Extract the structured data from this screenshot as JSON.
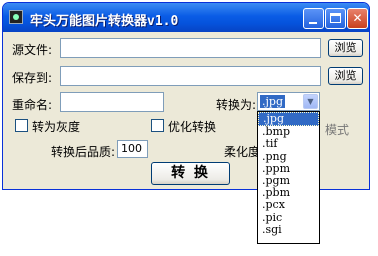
{
  "window": {
    "title": "牢头万能图片转换器v1.0",
    "minimize": "",
    "maximize": "",
    "close": "✕"
  },
  "form": {
    "source_label": "源文件:",
    "source_value": "",
    "browse1": "浏览",
    "save_label": "保存到:",
    "save_value": "",
    "browse2": "浏览",
    "rename_label": "重命名:",
    "rename_value": "",
    "convert_to_label": "转换为:",
    "format_selected": ".jpg",
    "gray_label": "转为灰度",
    "optimize_label": "优化转换",
    "mode_label": "模式",
    "quality_label": "转换后品质:",
    "quality_value": "100",
    "soften_label": "柔化度",
    "convert_button": "转 换"
  },
  "format_options": [
    ".jpg",
    ".bmp",
    ".tif",
    ".png",
    ".ppm",
    ".pgm",
    ".pbm",
    ".pcx",
    ".pic",
    ".sgi"
  ]
}
